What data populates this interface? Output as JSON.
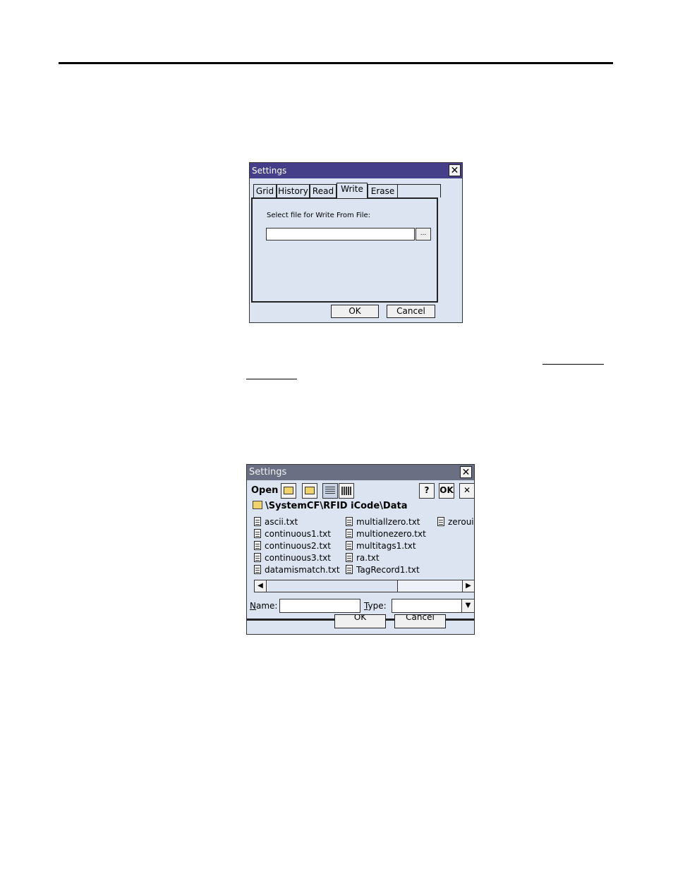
{
  "dialog_write": {
    "title": "Settings",
    "close_symbol": "✕",
    "tabs": [
      {
        "label": "Grid"
      },
      {
        "label": "History"
      },
      {
        "label": "Read"
      },
      {
        "label": "Write",
        "active": true
      },
      {
        "label": "Erase"
      }
    ],
    "field_label": "Select file for Write From File:",
    "path_value": "",
    "browse_label": "...",
    "ok_label": "OK",
    "cancel_label": "Cancel"
  },
  "dialog_open": {
    "title": "Settings",
    "close_symbol": "✕",
    "open_label": "Open",
    "toolbar": {
      "help_label": "?",
      "ok_label": "OK",
      "close_label": "✕"
    },
    "current_path": "\\SystemCF\\RFID iCode\\Data",
    "files": [
      "ascii.txt",
      "continuous1.txt",
      "continuous2.txt",
      "continuous3.txt",
      "datamismatch.txt",
      "multiallzero.txt",
      "multionezero.txt",
      "multitags1.txt",
      "ra.txt",
      "TagRecord1.txt",
      "zerouic"
    ],
    "name_label_accel": "N",
    "name_label_rest": "ame:",
    "name_value": "",
    "type_label_accel": "T",
    "type_label_rest": "ype:",
    "type_value": "",
    "ok_label": "OK",
    "cancel_label": "Cancel"
  },
  "colors": {
    "titlebar_active": "#453f8a",
    "titlebar_inactive": "#6a6f84",
    "dialog_bg": "#dbe4f0"
  }
}
